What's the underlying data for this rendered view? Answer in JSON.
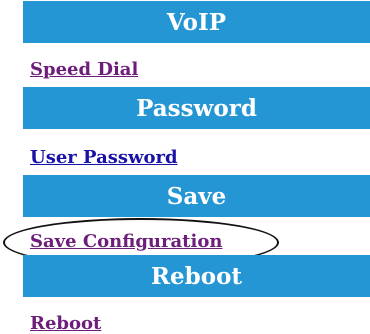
{
  "sections": [
    {
      "header": "VoIP",
      "link": "Speed Dial",
      "link_state": "visited"
    },
    {
      "header": "Password",
      "link": "User Password",
      "link_state": "normal"
    },
    {
      "header": "Save",
      "link": "Save Configuration",
      "link_state": "visited"
    },
    {
      "header": "Reboot",
      "link": "Reboot",
      "link_state": "visited"
    }
  ],
  "colors": {
    "header_bg": "#2596d4",
    "header_text": "#ffffff",
    "link_visited": "#6d1d7a",
    "link_normal": "#1a12a7",
    "highlight_ellipse": "#111111"
  }
}
